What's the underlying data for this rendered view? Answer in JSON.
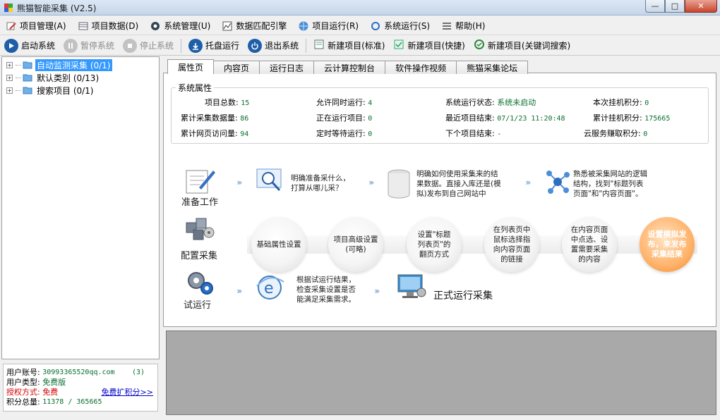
{
  "window": {
    "title": "熊猫智能采集 (V2.5)"
  },
  "menu": [
    {
      "label": "项目管理(A)",
      "icon": "project-manage-icon"
    },
    {
      "label": "项目数据(D)",
      "icon": "project-data-icon"
    },
    {
      "label": "系统管理(U)",
      "icon": "system-manage-icon"
    },
    {
      "label": "数据匹配引擎",
      "icon": "data-match-icon"
    },
    {
      "label": "项目运行(R)",
      "icon": "project-run-icon"
    },
    {
      "label": "系统运行(S)",
      "icon": "system-run-icon"
    },
    {
      "label": "帮助(H)",
      "icon": "help-icon"
    }
  ],
  "toolbar": {
    "start": "启动系统",
    "pause": "暂停系统",
    "stop": "停止系统",
    "tray": "托盘运行",
    "exit": "退出系统",
    "new_standard": "新建项目(标准)",
    "new_fast": "新建项目(快捷)",
    "new_keyword": "新建项目(关键词搜索)"
  },
  "tree": [
    {
      "label": "自动监测采集 (0/1)",
      "selected": true
    },
    {
      "label": "默认类别 (0/13)",
      "selected": false
    },
    {
      "label": "搜索项目 (0/1)",
      "selected": false
    }
  ],
  "account": {
    "user_label": "用户账号:",
    "user_value": "30993365520qq.com",
    "badge": "(3)",
    "type_label": "用户类型:",
    "type_value": "免费版",
    "auth_label": "授权方式:",
    "auth_value": "免费",
    "expand_link": "免费扩积分>>",
    "points_label": "积分总量:",
    "points_value": "11378 / 365665"
  },
  "tabs": [
    "属性页",
    "内容页",
    "运行日志",
    "云计算控制台",
    "软件操作视频",
    "熊猫采集论坛"
  ],
  "props": {
    "legend": "系统属性",
    "total_label": "项目总数:",
    "total_value": "15",
    "concurrent_label": "允许同时运行:",
    "concurrent_value": "4",
    "status_label": "系统运行状态:",
    "status_value": "系统未启动",
    "hang_label": "本次挂机积分:",
    "hang_value": "0",
    "collected_label": "累计采集数据量:",
    "collected_value": "86",
    "running_label": "正在运行项目:",
    "running_value": "0",
    "last_end_label": "最近项目结束:",
    "last_end_value": "07/1/23 11:20:48",
    "total_hang_label": "累计挂机积分:",
    "total_hang_value": "175665",
    "visits_label": "累计网页访问量:",
    "visits_value": "94",
    "scheduled_label": "定时等待运行:",
    "scheduled_value": "0",
    "next_label": "下个项目结束:",
    "next_value": "-",
    "cloud_label": "云服务赚取积分:",
    "cloud_value": "0"
  },
  "workflow": {
    "prepare": "准备工作",
    "configure": "配置采集",
    "trial": "试运行",
    "step1": "明确准备采什么，\n打算从哪儿采？",
    "step2": "明确如何使用采集来的结\n果数据。直接入库还是(模\n拟)发布到自己网站中",
    "step3": "熟悉被采集网站的逻辑\n结构，找到\"标题列表\n页面\"和\"内容页面\"。",
    "bubble1": "基础属性设置",
    "bubble2": "项目高级设置\n(可略)",
    "bubble3": "设置\"标题\n列表页\"的\n翻页方式",
    "bubble4": "在列表页中\n鼠标选择指\n向内容页面\n的链接",
    "bubble5": "在内容页面\n中点选、设\n置需要采集\n的内容",
    "bubble6": "设置模拟发\n布，来发布\n采集结果",
    "trial_text": "根据试运行结果，\n检查采集设置是否\n能满足采集需求。",
    "formal": "正式运行采集"
  },
  "colors": {
    "selected": "#3399ff",
    "value_green": "#0b6e30",
    "accent_red": "#d40000",
    "gray_area": "#a9a9a9"
  }
}
